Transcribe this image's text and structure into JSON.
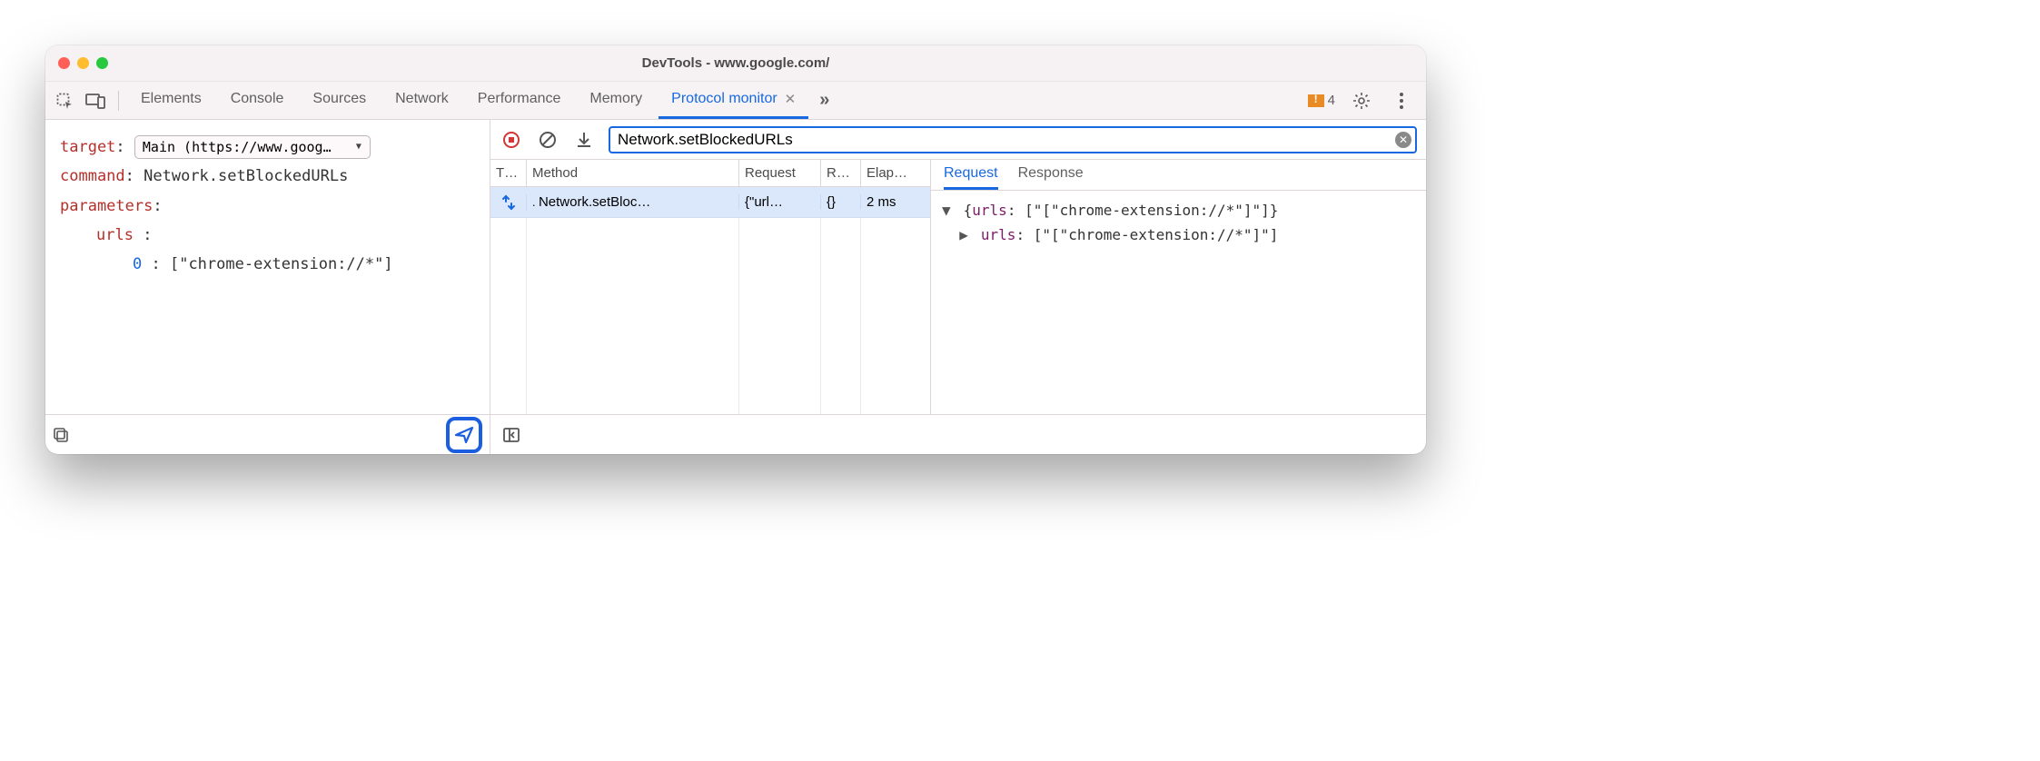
{
  "window": {
    "title": "DevTools - www.google.com/"
  },
  "tabs": {
    "items": [
      "Elements",
      "Console",
      "Sources",
      "Network",
      "Performance",
      "Memory",
      "Protocol monitor"
    ],
    "active_index": 6,
    "warnings_count": "4"
  },
  "editor": {
    "target_label": "target",
    "target_value": "Main (https://www.goog…",
    "command_label": "command",
    "command_value": "Network.setBlockedURLs",
    "parameters_label": "parameters",
    "param_key": "urls",
    "param_index": "0",
    "param_value": "[\"chrome-extension://*\"]"
  },
  "protocol": {
    "filter_value": "Network.setBlockedURLs",
    "columns": {
      "type": "T…",
      "method": "Method",
      "request": "Request",
      "response": "R…",
      "elapsed": "Elap…"
    },
    "rows": [
      {
        "method": "Network.setBloc…",
        "request": "{\"url…",
        "response": "{}",
        "elapsed": "2 ms"
      }
    ],
    "details_tabs": {
      "request": "Request",
      "response": "Response",
      "active": "request"
    },
    "tree": {
      "line1_prefix": "{",
      "line1_key": "urls",
      "line1_val": "[\"[\"chrome-extension://*\"]\"]}",
      "line2_key": "urls",
      "line2_val": "[\"[\"chrome-extension://*\"]\"]"
    }
  }
}
